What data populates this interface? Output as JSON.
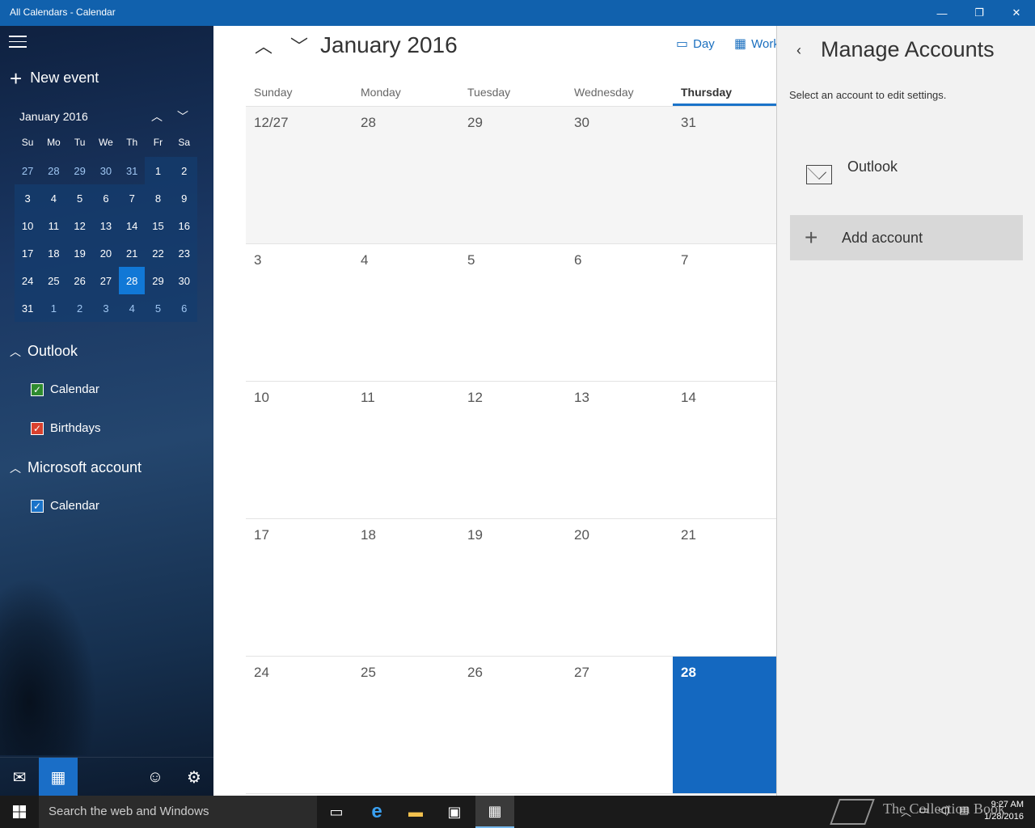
{
  "window": {
    "title": "All Calendars - Calendar",
    "controls": [
      "—",
      "❐",
      "✕"
    ]
  },
  "sidebar": {
    "new_event_label": "New event",
    "minical": {
      "title": "January 2016",
      "dow": [
        "Su",
        "Mo",
        "Tu",
        "We",
        "Th",
        "Fr",
        "Sa"
      ],
      "weeks": [
        [
          "27",
          "28",
          "29",
          "30",
          "31",
          "1",
          "2"
        ],
        [
          "3",
          "4",
          "5",
          "6",
          "7",
          "8",
          "9"
        ],
        [
          "10",
          "11",
          "12",
          "13",
          "14",
          "15",
          "16"
        ],
        [
          "17",
          "18",
          "19",
          "20",
          "21",
          "22",
          "23"
        ],
        [
          "24",
          "25",
          "26",
          "27",
          "28",
          "29",
          "30"
        ],
        [
          "31",
          "1",
          "2",
          "3",
          "4",
          "5",
          "6"
        ]
      ]
    },
    "groups": [
      {
        "name": "Outlook",
        "calendars": [
          {
            "label": "Calendar",
            "color": "#2e8b2e"
          },
          {
            "label": "Birthdays",
            "color": "#d9412e"
          }
        ]
      },
      {
        "name": "Microsoft account",
        "calendars": [
          {
            "label": "Calendar",
            "color": "#1a73c9"
          }
        ]
      }
    ]
  },
  "main": {
    "month_title": "January 2016",
    "views": {
      "day": "Day",
      "work_week": "Work"
    },
    "dow": [
      "Sunday",
      "Monday",
      "Tuesday",
      "Wednesday",
      "Thursday"
    ],
    "weeks": [
      [
        "12/27",
        "28",
        "29",
        "30",
        "31"
      ],
      [
        "3",
        "4",
        "5",
        "6",
        "7"
      ],
      [
        "10",
        "11",
        "12",
        "13",
        "14"
      ],
      [
        "17",
        "18",
        "19",
        "20",
        "21"
      ],
      [
        "24",
        "25",
        "26",
        "27",
        "28"
      ]
    ]
  },
  "panel": {
    "title": "Manage Accounts",
    "subtitle": "Select an account to edit settings.",
    "account_name": "Outlook",
    "add_account_label": "Add account"
  },
  "taskbar": {
    "search_placeholder": "Search the web and Windows",
    "time": "9:27 AM",
    "date": "1/28/2016"
  },
  "watermark": "The Collection Book",
  "colors": {
    "accent": "#1468c0",
    "titlebar": "#1161ad"
  }
}
